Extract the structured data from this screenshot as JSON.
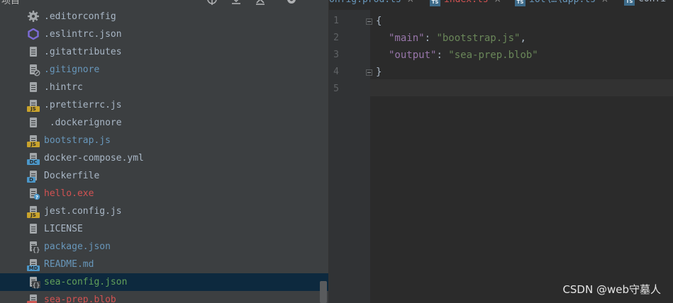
{
  "project": {
    "title": "项目",
    "files": [
      {
        "name": ".editorconfig",
        "icon": "gear-icon",
        "color": "#a9b7c6"
      },
      {
        "name": ".eslintrc.json",
        "icon": "eslint-icon",
        "color": "#a9b7c6"
      },
      {
        "name": ".gitattributes",
        "icon": "text-file-icon",
        "color": "#a9b7c6"
      },
      {
        "name": ".gitignore",
        "icon": "ignored-file-icon",
        "color": "#6897bb"
      },
      {
        "name": ".hintrc",
        "icon": "text-file-icon",
        "color": "#a9b7c6"
      },
      {
        "name": ".prettierrc.js",
        "icon": "js-file-icon",
        "color": "#a9b7c6"
      },
      {
        "name": " .dockerignore",
        "icon": "text-file-icon",
        "color": "#a9b7c6"
      },
      {
        "name": "bootstrap.js",
        "icon": "js-file-icon",
        "color": "#6897bb"
      },
      {
        "name": "docker-compose.yml",
        "icon": "docker-compose-file-icon",
        "color": "#a9b7c6"
      },
      {
        "name": "Dockerfile",
        "icon": "dockerfile-icon",
        "color": "#a9b7c6"
      },
      {
        "name": "hello.exe",
        "icon": "unknown-file-icon",
        "color": "#d25252"
      },
      {
        "name": "jest.config.js",
        "icon": "js-file-icon",
        "color": "#a9b7c6"
      },
      {
        "name": "LICENSE",
        "icon": "text-file-icon",
        "color": "#a9b7c6"
      },
      {
        "name": "package.json",
        "icon": "json-file-icon",
        "color": "#6897bb"
      },
      {
        "name": "README.md",
        "icon": "markdown-file-icon",
        "color": "#6897bb"
      },
      {
        "name": "sea-config.json",
        "icon": "json-file-icon",
        "color": "#62a05a",
        "selected": true
      },
      {
        "name": "sea-prep.blob",
        "icon": "blob-file-icon",
        "color": "#d25252"
      }
    ]
  },
  "editor": {
    "tabs": [
      {
        "label": "onfig.prod.ts",
        "color": "#6897bb",
        "ts": false,
        "close": "×"
      },
      {
        "label": "index.ts",
        "color": "#d25252",
        "ts": true,
        "ts_label": "TS",
        "close": "×"
      },
      {
        "label": "iot\\…\\app.ts",
        "color": "#6897bb",
        "ts": true,
        "ts_label": "TS",
        "close": "×"
      },
      {
        "label": "confi",
        "color": "#a9b7c6",
        "ts": true,
        "ts_label": "TS",
        "close": ""
      }
    ],
    "line_numbers": [
      "1",
      "2",
      "3",
      "4",
      "5"
    ],
    "code": {
      "open_brace": "{",
      "key1": "\"main\"",
      "val1": "\"bootstrap.js\"",
      "key2": "\"output\"",
      "val2": "\"sea-prep.blob\"",
      "close_brace": "}",
      "colon": ": ",
      "comma": ","
    }
  },
  "watermark": "CSDN @web守墓人",
  "colors": {
    "panel_bg": "#3c3f41",
    "editor_bg": "#2b2b2b",
    "selection": "#0d293e",
    "json_key": "#9876aa",
    "json_string": "#6a8759"
  }
}
